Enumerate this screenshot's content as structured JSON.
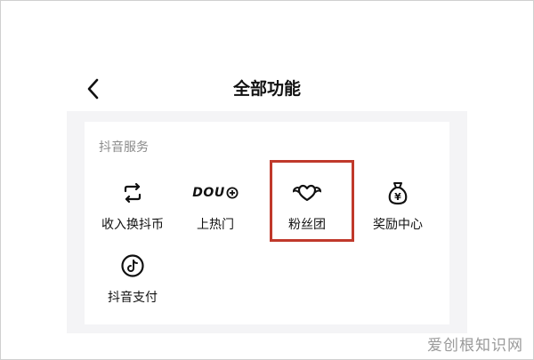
{
  "header": {
    "title": "全部功能",
    "back_icon": "chevron-left-icon"
  },
  "section": {
    "title": "抖音服务",
    "items": [
      {
        "label": "收入换抖币",
        "icon": "exchange-icon"
      },
      {
        "label": "上热门",
        "icon": "dou-plus-icon",
        "icon_text": "DOU"
      },
      {
        "label": "粉丝团",
        "icon": "winged-heart-icon"
      },
      {
        "label": "奖励中心",
        "icon": "money-bag-icon",
        "icon_text": "¥"
      },
      {
        "label": "抖音支付",
        "icon": "tiktok-pay-icon"
      }
    ]
  },
  "highlight": {
    "color": "#c0392b",
    "target": "粉丝团"
  },
  "watermark": "爱创根知识网"
}
